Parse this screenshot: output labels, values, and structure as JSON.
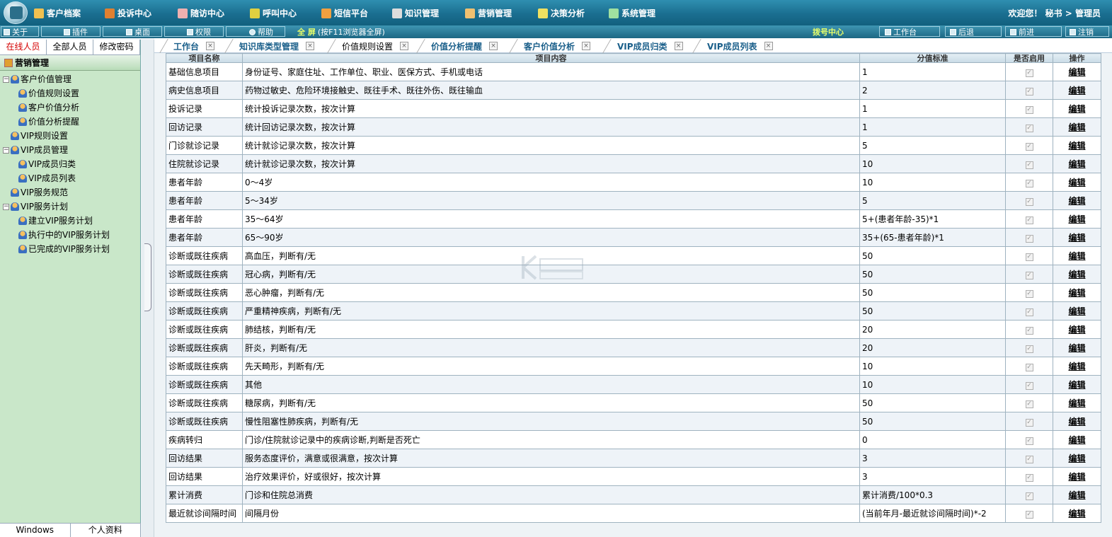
{
  "topmenu": {
    "items": [
      {
        "label": "客户档案",
        "icon": "customer-file-icon",
        "color": "#f0c050"
      },
      {
        "label": "投诉中心",
        "icon": "complaint-icon",
        "color": "#e08030"
      },
      {
        "label": "随访中心",
        "icon": "followup-icon",
        "color": "#f0b0b0"
      },
      {
        "label": "呼叫中心",
        "icon": "call-icon",
        "color": "#e0d040"
      },
      {
        "label": "短信平台",
        "icon": "sms-icon",
        "color": "#f0a040"
      },
      {
        "label": "知识管理",
        "icon": "knowledge-icon",
        "color": "#ddd"
      },
      {
        "label": "营销管理",
        "icon": "marketing-icon",
        "color": "#f0c070"
      },
      {
        "label": "决策分析",
        "icon": "decision-icon",
        "color": "#f0e060"
      },
      {
        "label": "系统管理",
        "icon": "system-icon",
        "color": "#a0e0a0"
      }
    ],
    "welcome": "欢迎您！ 秘书 > 管理员"
  },
  "toolbar": {
    "about": "关于",
    "plugin": "插件",
    "desktop": "桌面",
    "permission": "权限",
    "help": "帮助",
    "fullscreen": "全 屏",
    "fullscreen_hint": "(按F11浏览器全屏)",
    "dial": "拨号中心",
    "workbench": "工作台",
    "back": "后退",
    "forward": "前进",
    "logout": "注销"
  },
  "left": {
    "tabs": [
      "在线人员",
      "全部人员",
      "修改密码"
    ],
    "header": "营销管理",
    "tree": [
      {
        "label": "客户价值管理",
        "level": 0,
        "toggle": "−"
      },
      {
        "label": "价值规则设置",
        "level": 1
      },
      {
        "label": "客户价值分析",
        "level": 1
      },
      {
        "label": "价值分析提醒",
        "level": 1
      },
      {
        "label": "VIP规则设置",
        "level": 0
      },
      {
        "label": "VIP成员管理",
        "level": 0,
        "toggle": "−"
      },
      {
        "label": "VIP成员归类",
        "level": 1
      },
      {
        "label": "VIP成员列表",
        "level": 1
      },
      {
        "label": "VIP服务规范",
        "level": 0
      },
      {
        "label": "VIP服务计划",
        "level": 0,
        "toggle": "−"
      },
      {
        "label": "建立VIP服务计划",
        "level": 1
      },
      {
        "label": "执行中的VIP服务计划",
        "level": 1
      },
      {
        "label": "已完成的VIP服务计划",
        "level": 1
      }
    ],
    "bottom_tabs": [
      "Windows",
      "个人资料"
    ]
  },
  "tabs": [
    {
      "label": "工作台"
    },
    {
      "label": "知识库类型管理"
    },
    {
      "label": "价值规则设置"
    },
    {
      "label": "价值分析提醒"
    },
    {
      "label": "客户价值分析"
    },
    {
      "label": "VIP成员归类"
    },
    {
      "label": "VIP成员列表"
    }
  ],
  "close_glyph": "×",
  "table": {
    "headers": [
      "项目名称",
      "项目内容",
      "分值标准",
      "是否启用",
      "操作"
    ],
    "edit_label": "编辑",
    "check_glyph": "✓",
    "rows": [
      [
        "基础信息项目",
        "身份证号、家庭住址、工作单位、职业、医保方式、手机或电话",
        "1"
      ],
      [
        "病史信息项目",
        "药物过敏史、危险环境接触史、既往手术、既往外伤、既往输血",
        "2"
      ],
      [
        "投诉记录",
        "统计投诉记录次数，按次计算",
        "1"
      ],
      [
        "回访记录",
        "统计回访记录次数，按次计算",
        "1"
      ],
      [
        "门诊就诊记录",
        "统计就诊记录次数，按次计算",
        "5"
      ],
      [
        "住院就诊记录",
        "统计就诊记录次数，按次计算",
        "10"
      ],
      [
        "患者年龄",
        "0～4岁",
        "10"
      ],
      [
        "患者年龄",
        "5～34岁",
        "5"
      ],
      [
        "患者年龄",
        "35～64岁",
        "5+(患者年龄-35)*1"
      ],
      [
        "患者年龄",
        "65～90岁",
        "35+(65-患者年龄)*1"
      ],
      [
        "诊断或既往疾病",
        "高血压，判断有/无",
        "50"
      ],
      [
        "诊断或既往疾病",
        "冠心病，判断有/无",
        "50"
      ],
      [
        "诊断或既往疾病",
        "恶心肿瘤，判断有/无",
        "50"
      ],
      [
        "诊断或既往疾病",
        "严重精神疾病，判断有/无",
        "50"
      ],
      [
        "诊断或既往疾病",
        "肺结核，判断有/无",
        "20"
      ],
      [
        "诊断或既往疾病",
        "肝炎，判断有/无",
        "20"
      ],
      [
        "诊断或既往疾病",
        "先天畸形，判断有/无",
        "10"
      ],
      [
        "诊断或既往疾病",
        "其他",
        "10"
      ],
      [
        "诊断或既往疾病",
        "糖尿病，判断有/无",
        "50"
      ],
      [
        "诊断或既往疾病",
        "慢性阻塞性肺疾病，判断有/无",
        "50"
      ],
      [
        "疾病转归",
        "门诊/住院就诊记录中的疾病诊断,判断是否死亡",
        "0"
      ],
      [
        "回访结果",
        "服务态度评价，满意或很满意，按次计算",
        "3"
      ],
      [
        "回访结果",
        "治疗效果评价，好或很好，按次计算",
        "3"
      ],
      [
        "累计消费",
        "门诊和住院总消费",
        "累计消费/100*0.3"
      ],
      [
        "最近就诊间隔时间",
        "间隔月份",
        "(当前年月-最近就诊间隔时间)*-2"
      ]
    ]
  }
}
